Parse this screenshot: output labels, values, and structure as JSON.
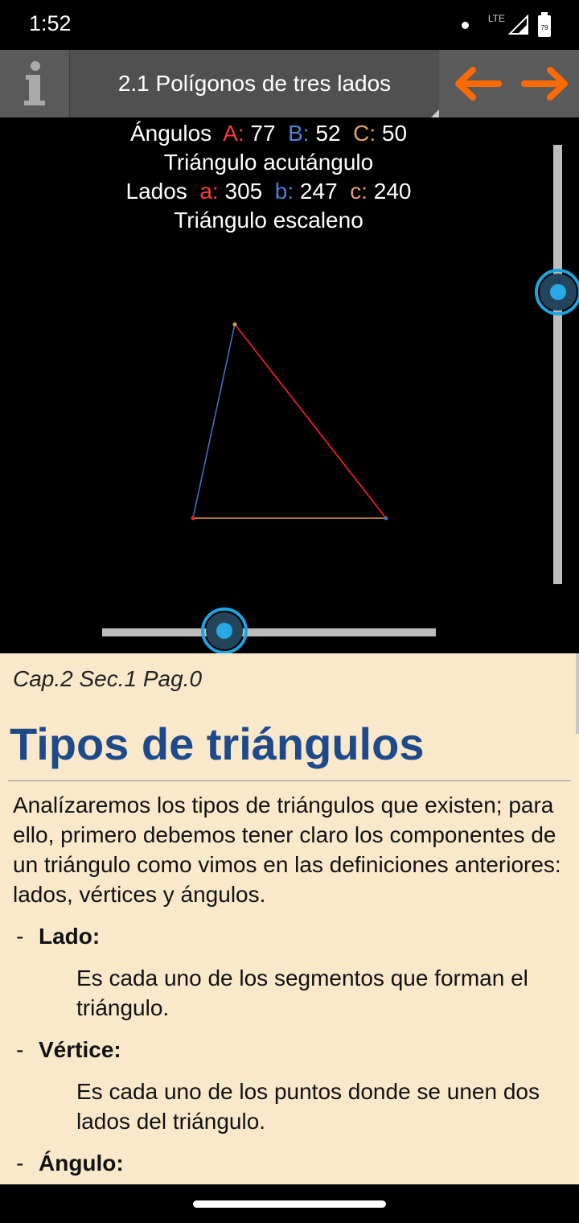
{
  "status": {
    "time": "1:52",
    "network": "LTE",
    "battery": "79"
  },
  "appbar": {
    "title": "2.1 Polígonos de tres lados"
  },
  "triangle_info": {
    "angles_label": "Ángulos",
    "angle_A_label": "A:",
    "angle_A": "77",
    "angle_B_label": "B:",
    "angle_B": "52",
    "angle_C_label": "C:",
    "angle_C": "50",
    "angle_type": "Triángulo acutángulo",
    "sides_label": "Lados",
    "side_a_label": "a:",
    "side_a": "305",
    "side_b_label": "b:",
    "side_b": "247",
    "side_c_label": "c:",
    "side_c": "240",
    "side_type": "Triángulo escaleno"
  },
  "sliders": {
    "vertical_value": 0.67,
    "horizontal_value": 0.37
  },
  "colors": {
    "side_a": "#ff2020",
    "side_b": "#3f6fc8",
    "side_c": "#e0a050",
    "accent": "#ff6a00",
    "content_bg": "#fae8cb",
    "heading": "#1e4a8a"
  },
  "content": {
    "page_ref": "Cap.2 Sec.1 Pag.0",
    "heading": "Tipos de triángulos",
    "intro": "Analízaremos los tipos de triángulos que existen; para ello, primero debemos tener claro los componentes de un triángulo como vimos en las definiciones anteriores: lados, vértices y ángulos.",
    "items": [
      {
        "dash": "-",
        "term": "Lado:",
        "desc": "Es cada uno de los segmentos que forman el triángulo."
      },
      {
        "dash": "-",
        "term": "Vértice:",
        "desc": "Es cada uno de los puntos donde se unen dos lados del triángulo."
      },
      {
        "dash": "-",
        "term": "Ángulo:",
        "desc": ""
      }
    ]
  }
}
